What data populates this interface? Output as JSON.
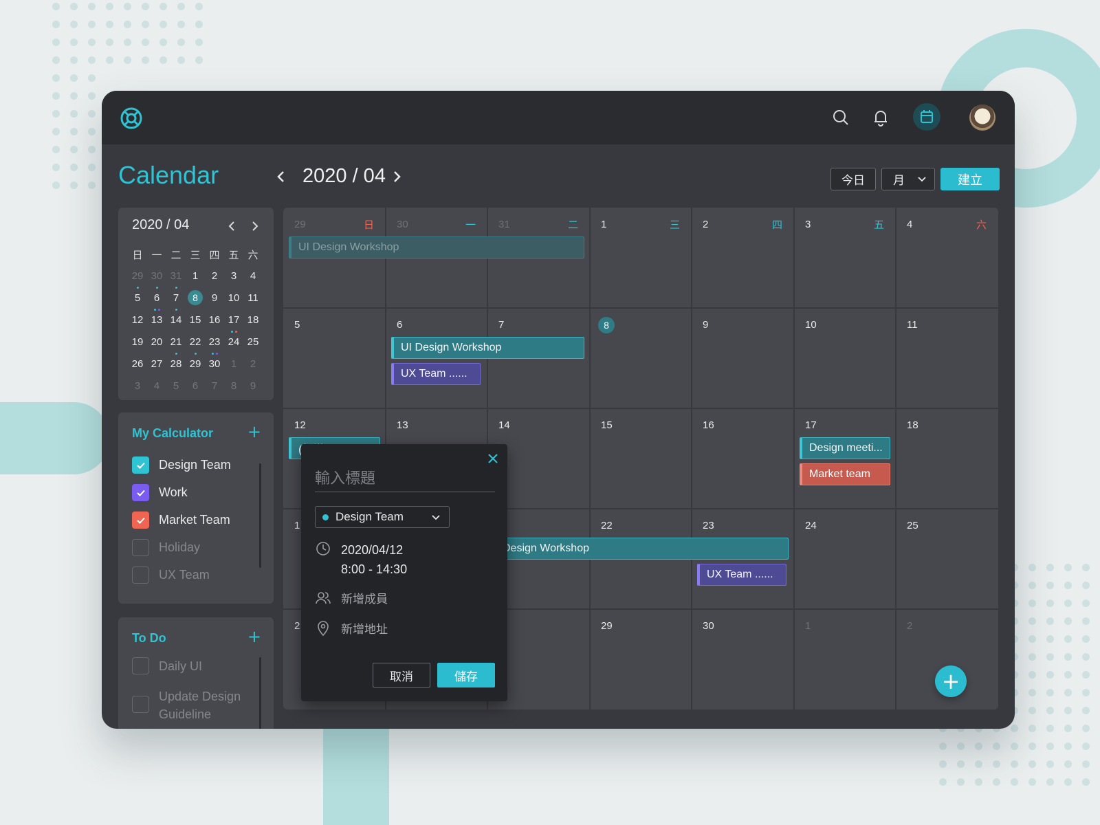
{
  "header": {
    "page_title": "Calendar",
    "month_label": "2020 / 04",
    "today_button": "今日",
    "view_select": "月",
    "create_button": "建立"
  },
  "mini_calendar": {
    "title": "2020 / 04",
    "weekdays": [
      "日",
      "一",
      "二",
      "三",
      "四",
      "五",
      "六"
    ],
    "weeks": [
      [
        "29",
        "30",
        "31",
        "1",
        "2",
        "3",
        "4"
      ],
      [
        "5",
        "6",
        "7",
        "8",
        "9",
        "10",
        "11"
      ],
      [
        "12",
        "13",
        "14",
        "15",
        "16",
        "17",
        "18"
      ],
      [
        "19",
        "20",
        "21",
        "22",
        "23",
        "24",
        "25"
      ],
      [
        "26",
        "27",
        "28",
        "29",
        "30",
        "1",
        "2"
      ],
      [
        "3",
        "4",
        "5",
        "6",
        "7",
        "8",
        "9"
      ]
    ],
    "selected": "8"
  },
  "my_calendar": {
    "title": "My Calculator",
    "add": "+",
    "items": [
      {
        "label": "Design Team",
        "checked": true,
        "color": "#2fc3d3"
      },
      {
        "label": "Work",
        "checked": true,
        "color": "#7b5cf0"
      },
      {
        "label": "Market Team",
        "checked": true,
        "color": "#f06452"
      },
      {
        "label": "Holiday",
        "checked": false,
        "color": ""
      },
      {
        "label": "UX Team",
        "checked": false,
        "color": ""
      }
    ]
  },
  "todo": {
    "title": "To Do",
    "add": "+",
    "items": [
      {
        "label": "Daily UI"
      },
      {
        "label": "Update Design Guideline"
      }
    ]
  },
  "calendar": {
    "weekday_labels": [
      "日",
      "一",
      "二",
      "三",
      "四",
      "五",
      "六"
    ],
    "weekday_colors": [
      "#f06452",
      "#2fc3d3",
      "#2fc3d3",
      "#2fc3d3",
      "#2fc3d3",
      "#2fc3d3",
      "#f06452"
    ],
    "weeks": [
      [
        "29",
        "30",
        "31",
        "1",
        "2",
        "3",
        "4"
      ],
      [
        "5",
        "6",
        "7",
        "8",
        "9",
        "10",
        "11"
      ],
      [
        "12",
        "13",
        "14",
        "15",
        "16",
        "17",
        "18"
      ],
      [
        "1",
        "",
        "",
        "22",
        "23",
        "24",
        "25"
      ],
      [
        "2",
        "",
        "",
        "29",
        "30",
        "1",
        "2"
      ]
    ],
    "dim_days": [
      [
        0,
        0
      ],
      [
        0,
        1
      ],
      [
        0,
        2
      ],
      [
        4,
        5
      ],
      [
        4,
        6
      ]
    ],
    "today": [
      1,
      3
    ],
    "events": [
      {
        "label": "UI Design Workshop",
        "style": "teal-faded",
        "week": 0,
        "start": 0,
        "end": 2,
        "lane": 0
      },
      {
        "label": "UI Design Workshop",
        "style": "teal",
        "week": 1,
        "start": 1,
        "end": 2,
        "lane": 0
      },
      {
        "label": "UX Team ......",
        "style": "purple",
        "week": 1,
        "start": 1,
        "end": 1,
        "lane": 1
      },
      {
        "label": "(新增...)",
        "style": "teal",
        "week": 2,
        "start": 0,
        "end": 0,
        "lane": 0
      },
      {
        "label": "Design meeti...",
        "style": "teal",
        "week": 2,
        "start": 5,
        "end": 5,
        "lane": 0
      },
      {
        "label": "Market team",
        "style": "red",
        "week": 2,
        "start": 5,
        "end": 5,
        "lane": 1
      },
      {
        "label": "Design Workshop",
        "style": "teal",
        "week": 3,
        "start": 2,
        "end": 4,
        "lane": 0
      },
      {
        "label": "UX Team ......",
        "style": "purple",
        "week": 3,
        "start": 4,
        "end": 4,
        "lane": 1
      }
    ]
  },
  "popup": {
    "title_placeholder": "輸入標題",
    "calendar_select": "Design Team",
    "date": "2020/04/12",
    "time": "8:00 - 14:30",
    "add_member": "新增成員",
    "add_location": "新增地址",
    "cancel": "取消",
    "save": "儲存"
  },
  "fab": "+",
  "icons": [
    "logo-icon",
    "search-icon",
    "bell-icon",
    "calendar-icon",
    "avatar"
  ]
}
